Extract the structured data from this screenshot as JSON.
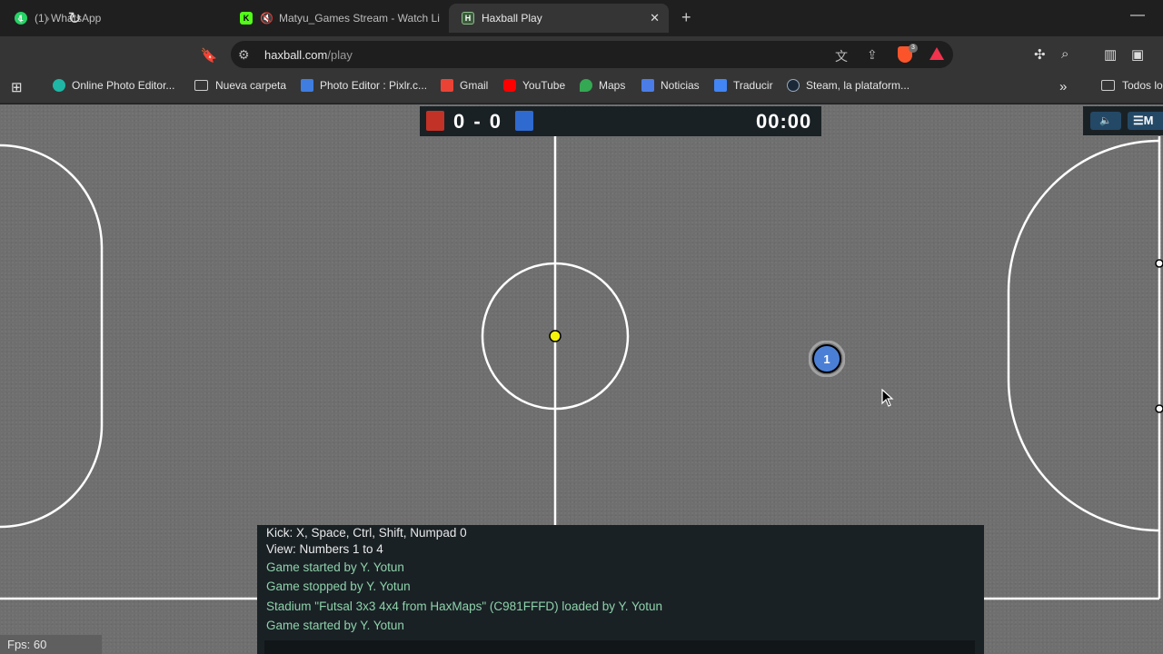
{
  "browser": {
    "tabs": [
      {
        "title": "(1) WhatsApp",
        "badge": "1",
        "color": "#25d366"
      },
      {
        "title": "Matyu_Games Stream - Watch Li",
        "badge": "K",
        "color": "#53fc18"
      },
      {
        "title": "Haxball Play",
        "badge": "H",
        "color": "#3a5b3a"
      }
    ],
    "address": {
      "host": "haxball.com",
      "path": "/play"
    },
    "bookmarks": [
      {
        "label": "Online Photo Editor...",
        "color": "#1fb6a6"
      },
      {
        "label": "Nueva carpeta",
        "color": "folder"
      },
      {
        "label": "Photo Editor : Pixlr.c...",
        "color": "#3f7de0"
      },
      {
        "label": "Gmail",
        "color": "#ea4335"
      },
      {
        "label": "YouTube",
        "color": "#ff0000"
      },
      {
        "label": "Maps",
        "color": "#34a853"
      },
      {
        "label": "Noticias",
        "color": "#4a7de8"
      },
      {
        "label": "Traducir",
        "color": "#4285f4"
      },
      {
        "label": "Steam, la plataform...",
        "color": "#1b2838"
      }
    ],
    "bookmarks_overflow_label": "Todos lo",
    "brave_badge_count": "3"
  },
  "game": {
    "score": "0 - 0",
    "red_team_color": "#c23227",
    "blue_team_color": "#2f6ad0",
    "timer": "00:00",
    "menu_label": "M",
    "player_number": "1",
    "chat": [
      {
        "text": "Kick: X, Space, Ctrl, Shift, Numpad 0",
        "style": "white"
      },
      {
        "text": "View: Numbers 1 to 4",
        "style": "white"
      },
      {
        "text": "Game started by Y. Yotun",
        "style": "green"
      },
      {
        "text": "Game stopped by Y. Yotun",
        "style": "green"
      },
      {
        "text": "Stadium \"Futsal 3x3 4x4 from HaxMaps\" (C981FFFD) loaded by Y. Yotun",
        "style": "green"
      },
      {
        "text": "Game started by Y. Yotun",
        "style": "green"
      }
    ],
    "fps": "Fps: 60"
  }
}
